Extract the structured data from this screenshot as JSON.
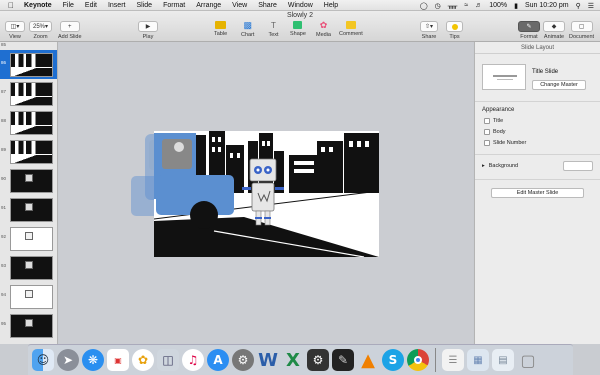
{
  "menubar": {
    "app": "Keynote",
    "items": [
      "File",
      "Edit",
      "Insert",
      "Slide",
      "Format",
      "Arrange",
      "View",
      "Share",
      "Window",
      "Help"
    ],
    "battery": "100%",
    "clock": "Sun 10:20 pm"
  },
  "toolbar": {
    "doc_title": "Slowly 2",
    "view_label": "View",
    "zoom_value": "25%",
    "zoom_label": "Zoom",
    "add_slide_label": "Add Slide",
    "play_label": "Play",
    "table_label": "Table",
    "chart_label": "Chart",
    "text_label": "Text",
    "shape_label": "Shape",
    "media_label": "Media",
    "comment_label": "Comment",
    "share_label": "Share",
    "tips_label": "Tips",
    "format_label": "Format",
    "animate_label": "Animate",
    "document_label": "Document"
  },
  "navigator": {
    "slides": [
      {
        "num": "85",
        "kind": "city"
      },
      {
        "num": "86",
        "kind": "city",
        "selected": true
      },
      {
        "num": "87",
        "kind": "city"
      },
      {
        "num": "88",
        "kind": "city"
      },
      {
        "num": "89",
        "kind": "city"
      },
      {
        "num": "90",
        "kind": "dark"
      },
      {
        "num": "91",
        "kind": "dark"
      },
      {
        "num": "92",
        "kind": "dice"
      },
      {
        "num": "93",
        "kind": "dark"
      },
      {
        "num": "94",
        "kind": "dice"
      },
      {
        "num": "95",
        "kind": "dark"
      }
    ]
  },
  "inspector": {
    "header": "Slide Layout",
    "master_name": "Title Slide",
    "change_master": "Change Master",
    "appearance_title": "Appearance",
    "options": [
      "Title",
      "Body",
      "Slide Number"
    ],
    "background_label": "Background",
    "edit_master": "Edit Master Slide"
  },
  "dock": {
    "icons": [
      "finder-icon",
      "launchpad-icon",
      "safari-icon",
      "calendar-icon",
      "photos-icon",
      "preview-icon",
      "itunes-icon",
      "app-store-icon",
      "system-preferences-icon",
      "word-icon",
      "excel-icon",
      "imovie-icon",
      "final-cut-icon",
      "vlc-icon",
      "skype-icon",
      "chrome-icon",
      "document-stack-icon",
      "downloads-icon",
      "trash-icon"
    ]
  },
  "colors": {
    "accent": "#1f6fd1",
    "truck": "#5b8fd0",
    "robot_eye": "#3a63c7"
  }
}
